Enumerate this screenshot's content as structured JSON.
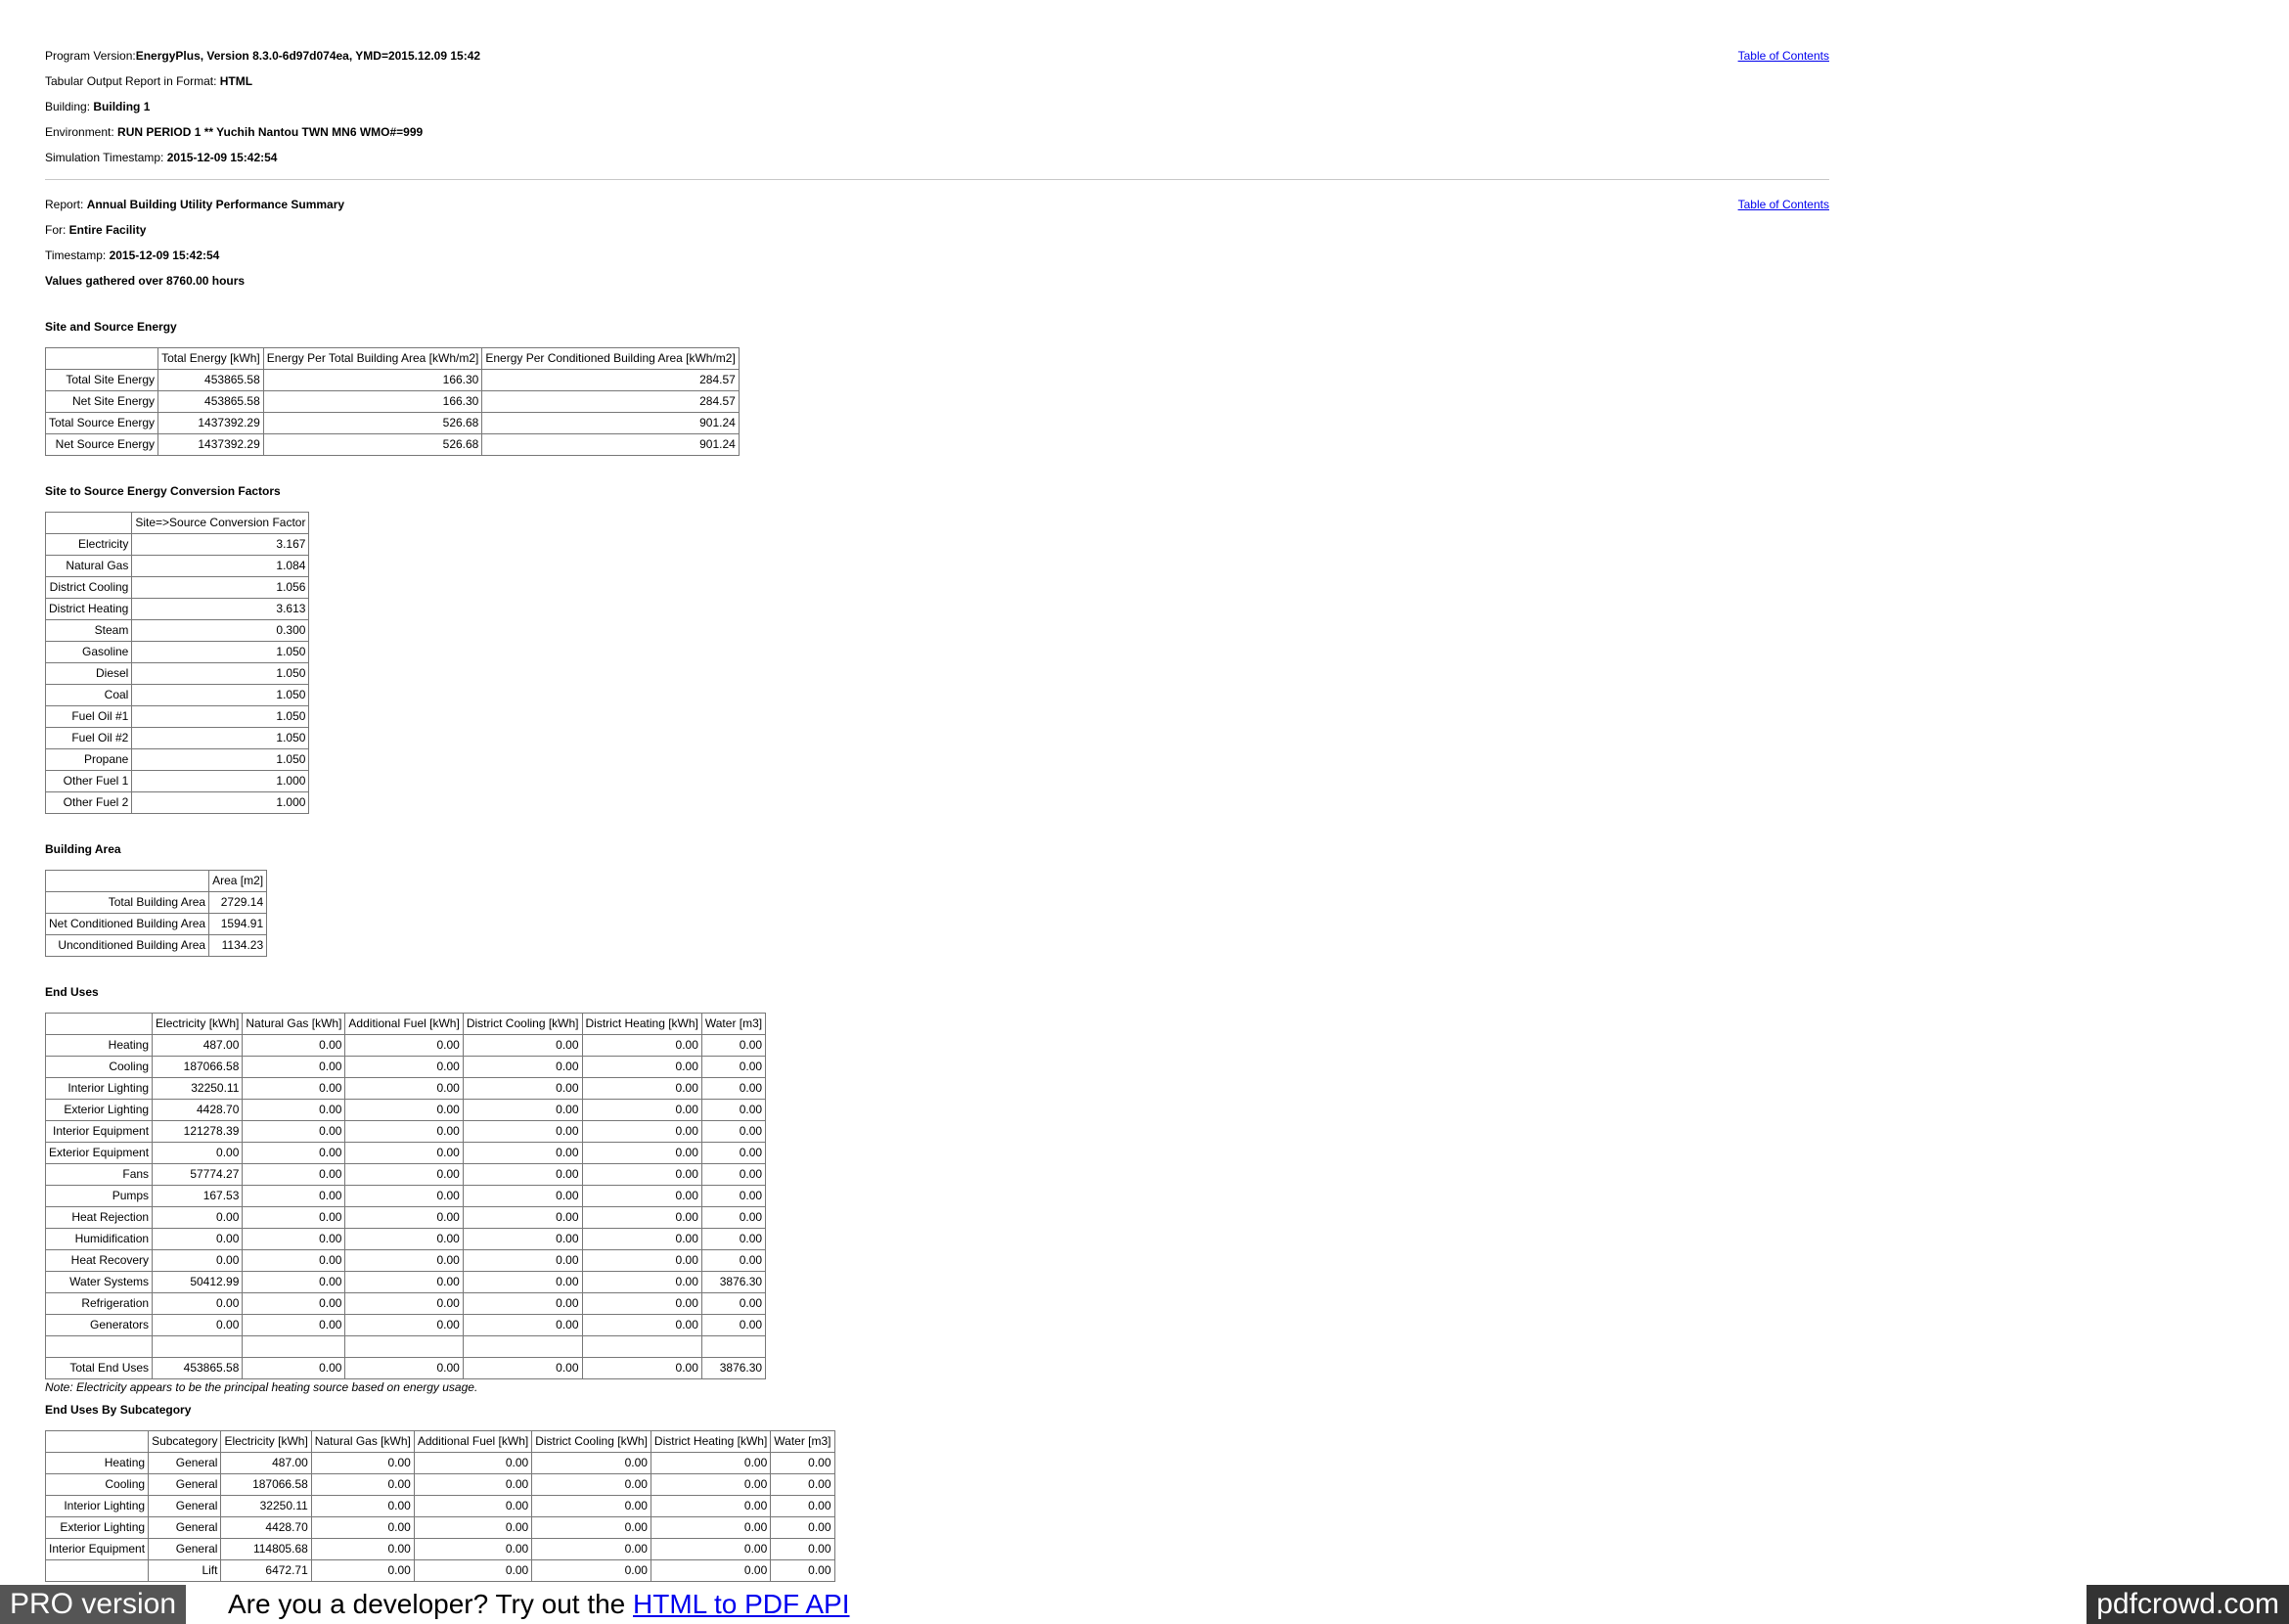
{
  "header": {
    "program_version_label": "Program Version:",
    "program_version": "EnergyPlus, Version 8.3.0-6d97d074ea, YMD=2015.12.09 15:42",
    "format_label": "Tabular Output Report in Format: ",
    "format": "HTML",
    "building_label": "Building: ",
    "building": "Building 1",
    "environment_label": "Environment: ",
    "environment": "RUN PERIOD 1 ** Yuchih Nantou TWN MN6 WMO#=999",
    "sim_timestamp_label": "Simulation Timestamp: ",
    "sim_timestamp": "2015-12-09 15:42:54",
    "toc": "Table of Contents"
  },
  "report": {
    "report_label": "Report: ",
    "report": "Annual Building Utility Performance Summary",
    "for_label": "For: ",
    "for": "Entire Facility",
    "timestamp_label": "Timestamp: ",
    "timestamp": "2015-12-09 15:42:54",
    "values_gathered": "Values gathered over 8760.00 hours",
    "toc": "Table of Contents"
  },
  "site_source": {
    "title": "Site and Source Energy",
    "headers": [
      "",
      "Total Energy [kWh]",
      "Energy Per Total Building Area [kWh/m2]",
      "Energy Per Conditioned Building Area [kWh/m2]"
    ],
    "rows": [
      [
        "Total Site Energy",
        "453865.58",
        "166.30",
        "284.57"
      ],
      [
        "Net Site Energy",
        "453865.58",
        "166.30",
        "284.57"
      ],
      [
        "Total Source Energy",
        "1437392.29",
        "526.68",
        "901.24"
      ],
      [
        "Net Source Energy",
        "1437392.29",
        "526.68",
        "901.24"
      ]
    ]
  },
  "conversion": {
    "title": "Site to Source Energy Conversion Factors",
    "headers": [
      "",
      "Site=>Source Conversion Factor"
    ],
    "rows": [
      [
        "Electricity",
        "3.167"
      ],
      [
        "Natural Gas",
        "1.084"
      ],
      [
        "District Cooling",
        "1.056"
      ],
      [
        "District Heating",
        "3.613"
      ],
      [
        "Steam",
        "0.300"
      ],
      [
        "Gasoline",
        "1.050"
      ],
      [
        "Diesel",
        "1.050"
      ],
      [
        "Coal",
        "1.050"
      ],
      [
        "Fuel Oil #1",
        "1.050"
      ],
      [
        "Fuel Oil #2",
        "1.050"
      ],
      [
        "Propane",
        "1.050"
      ],
      [
        "Other Fuel 1",
        "1.000"
      ],
      [
        "Other Fuel 2",
        "1.000"
      ]
    ]
  },
  "area": {
    "title": "Building Area",
    "headers": [
      "",
      "Area [m2]"
    ],
    "rows": [
      [
        "Total Building Area",
        "2729.14"
      ],
      [
        "Net Conditioned Building Area",
        "1594.91"
      ],
      [
        "Unconditioned Building Area",
        "1134.23"
      ]
    ]
  },
  "end_uses": {
    "title": "End Uses",
    "headers": [
      "",
      "Electricity [kWh]",
      "Natural Gas [kWh]",
      "Additional Fuel [kWh]",
      "District Cooling [kWh]",
      "District Heating [kWh]",
      "Water [m3]"
    ],
    "rows": [
      [
        "Heating",
        "487.00",
        "0.00",
        "0.00",
        "0.00",
        "0.00",
        "0.00"
      ],
      [
        "Cooling",
        "187066.58",
        "0.00",
        "0.00",
        "0.00",
        "0.00",
        "0.00"
      ],
      [
        "Interior Lighting",
        "32250.11",
        "0.00",
        "0.00",
        "0.00",
        "0.00",
        "0.00"
      ],
      [
        "Exterior Lighting",
        "4428.70",
        "0.00",
        "0.00",
        "0.00",
        "0.00",
        "0.00"
      ],
      [
        "Interior Equipment",
        "121278.39",
        "0.00",
        "0.00",
        "0.00",
        "0.00",
        "0.00"
      ],
      [
        "Exterior Equipment",
        "0.00",
        "0.00",
        "0.00",
        "0.00",
        "0.00",
        "0.00"
      ],
      [
        "Fans",
        "57774.27",
        "0.00",
        "0.00",
        "0.00",
        "0.00",
        "0.00"
      ],
      [
        "Pumps",
        "167.53",
        "0.00",
        "0.00",
        "0.00",
        "0.00",
        "0.00"
      ],
      [
        "Heat Rejection",
        "0.00",
        "0.00",
        "0.00",
        "0.00",
        "0.00",
        "0.00"
      ],
      [
        "Humidification",
        "0.00",
        "0.00",
        "0.00",
        "0.00",
        "0.00",
        "0.00"
      ],
      [
        "Heat Recovery",
        "0.00",
        "0.00",
        "0.00",
        "0.00",
        "0.00",
        "0.00"
      ],
      [
        "Water Systems",
        "50412.99",
        "0.00",
        "0.00",
        "0.00",
        "0.00",
        "3876.30"
      ],
      [
        "Refrigeration",
        "0.00",
        "0.00",
        "0.00",
        "0.00",
        "0.00",
        "0.00"
      ],
      [
        "Generators",
        "0.00",
        "0.00",
        "0.00",
        "0.00",
        "0.00",
        "0.00"
      ],
      [
        "",
        "",
        "",
        "",
        "",
        "",
        ""
      ],
      [
        "Total End Uses",
        "453865.58",
        "0.00",
        "0.00",
        "0.00",
        "0.00",
        "3876.30"
      ]
    ],
    "note": "Note: Electricity appears to be the principal heating source based on energy usage."
  },
  "subcategory": {
    "title": "End Uses By Subcategory",
    "headers": [
      "",
      "Subcategory",
      "Electricity [kWh]",
      "Natural Gas [kWh]",
      "Additional Fuel [kWh]",
      "District Cooling [kWh]",
      "District Heating [kWh]",
      "Water [m3]"
    ],
    "rows": [
      [
        "Heating",
        "General",
        "487.00",
        "0.00",
        "0.00",
        "0.00",
        "0.00",
        "0.00"
      ],
      [
        "Cooling",
        "General",
        "187066.58",
        "0.00",
        "0.00",
        "0.00",
        "0.00",
        "0.00"
      ],
      [
        "Interior Lighting",
        "General",
        "32250.11",
        "0.00",
        "0.00",
        "0.00",
        "0.00",
        "0.00"
      ],
      [
        "Exterior Lighting",
        "General",
        "4428.70",
        "0.00",
        "0.00",
        "0.00",
        "0.00",
        "0.00"
      ],
      [
        "Interior Equipment",
        "General",
        "114805.68",
        "0.00",
        "0.00",
        "0.00",
        "0.00",
        "0.00"
      ],
      [
        "",
        "Lift",
        "6472.71",
        "0.00",
        "0.00",
        "0.00",
        "0.00",
        "0.00"
      ]
    ]
  },
  "banner": {
    "pro": "PRO version",
    "dev_text": "Are you a developer? Try out the ",
    "dev_link": "HTML to PDF API",
    "brand": "pdfcrowd.com"
  }
}
